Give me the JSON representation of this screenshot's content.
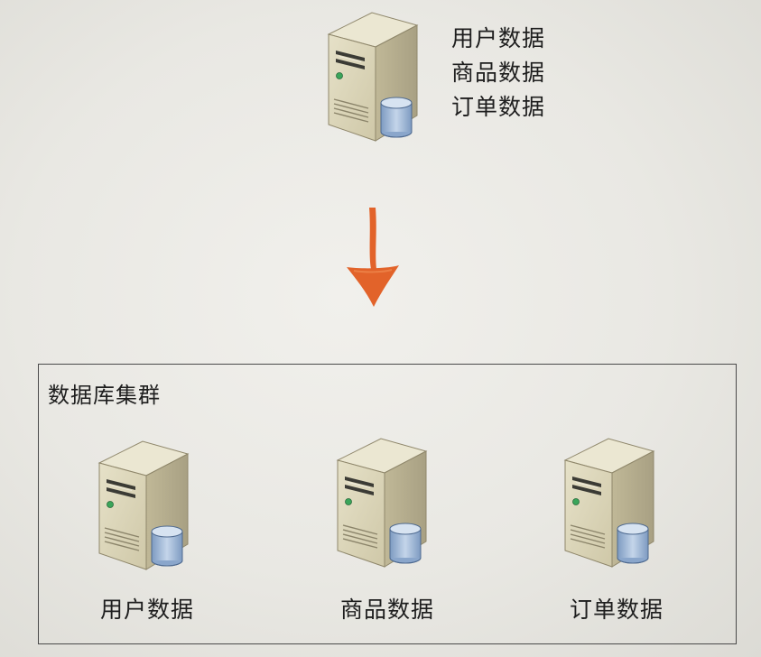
{
  "source": {
    "labels": [
      "用户数据",
      "商品数据",
      "订单数据"
    ]
  },
  "cluster": {
    "title": "数据库集群",
    "nodes": [
      {
        "label": "用户数据"
      },
      {
        "label": "商品数据"
      },
      {
        "label": "订单数据"
      }
    ]
  },
  "colors": {
    "arrow": "#e2632a",
    "server_body": "#d9d3b6",
    "server_side": "#b8b092",
    "database": "#9fb8d6",
    "cluster_border": "#4a4a4a"
  },
  "icons": {
    "server": "server-icon",
    "database": "database-icon",
    "arrow": "arrow-down-icon"
  }
}
